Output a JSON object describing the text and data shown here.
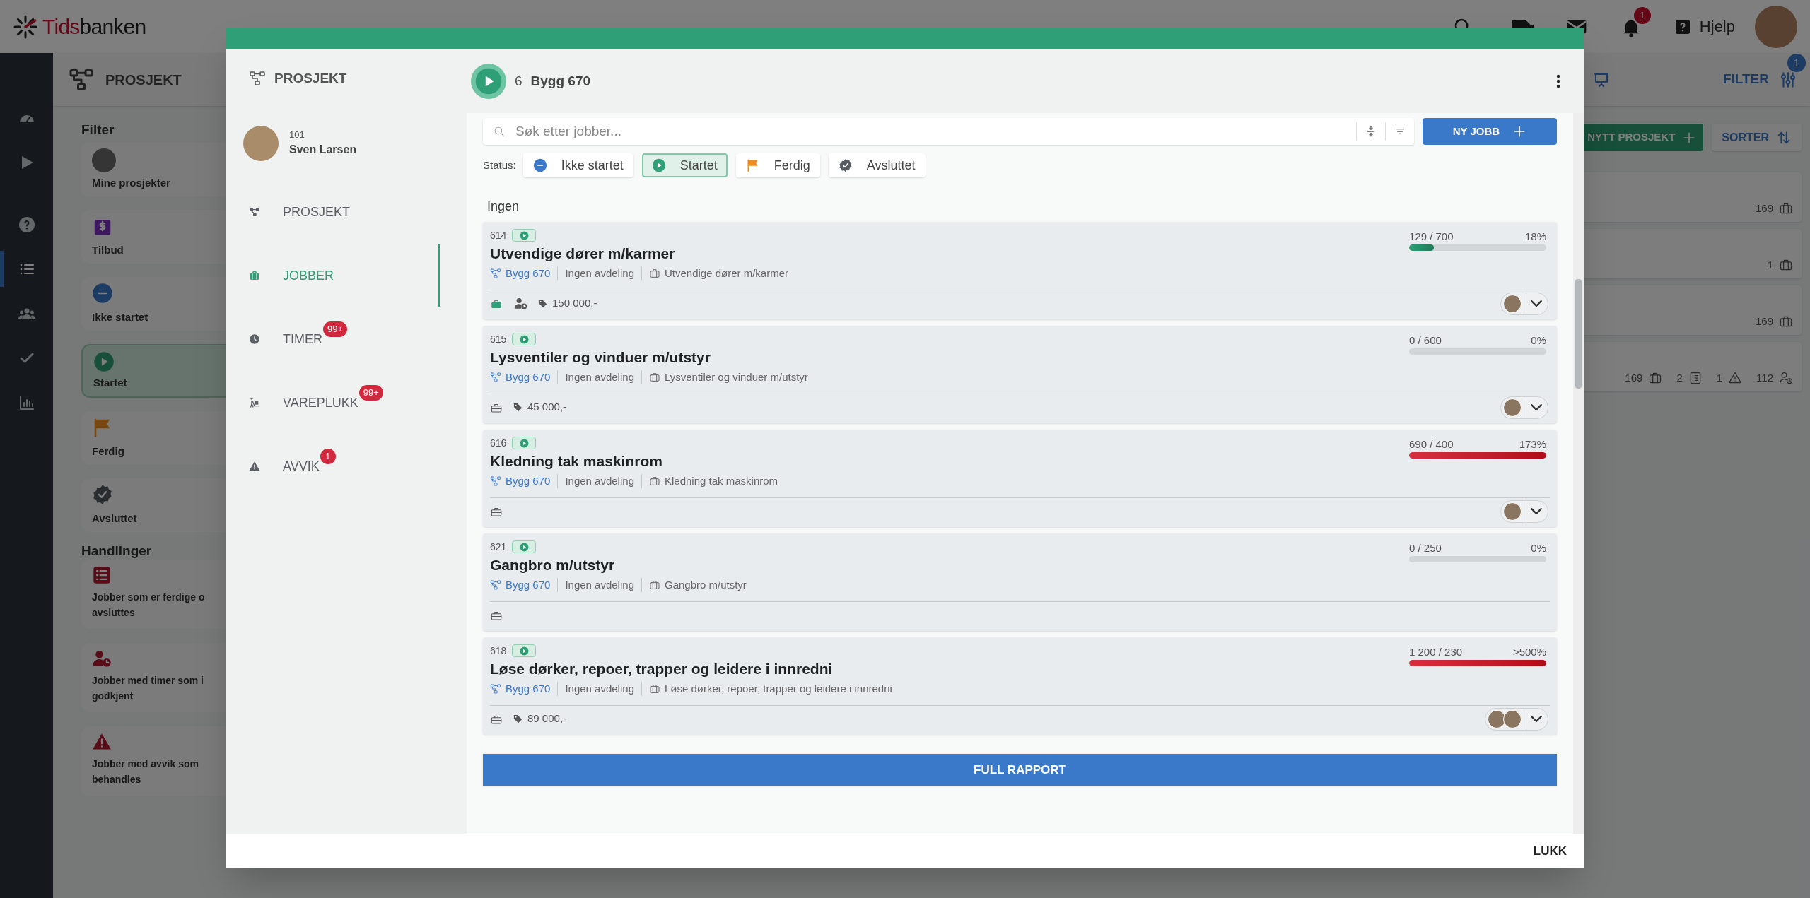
{
  "app": {
    "logo": {
      "accent": "Tids",
      "rest": "banken"
    },
    "help_label": "Hjelp",
    "notification_count": "1"
  },
  "rail": {
    "top": [
      {
        "kind": "dashboard",
        "selected": false
      },
      {
        "kind": "play",
        "selected": false
      }
    ],
    "bottom": [
      {
        "kind": "help",
        "selected": false
      },
      {
        "kind": "list",
        "selected": true
      },
      {
        "kind": "users",
        "selected": false
      },
      {
        "kind": "check",
        "selected": false
      },
      {
        "kind": "chart",
        "selected": false
      }
    ]
  },
  "page_header": {
    "title": "PROSJEKT",
    "filter_label": "FILTER",
    "filter_count": "1"
  },
  "sidebar": {
    "filter_heading": "Filter",
    "filters": [
      {
        "label": "Mine prosjekter",
        "kind": "photo",
        "selected": false
      },
      {
        "label": "Tilbud",
        "kind": "offer",
        "selected": false
      },
      {
        "label": "Ikke startet",
        "kind": "not_started",
        "selected": false
      },
      {
        "label": "Startet",
        "kind": "started",
        "selected": true
      },
      {
        "label": "Ferdig",
        "kind": "done",
        "selected": false
      },
      {
        "label": "Avsluttet",
        "kind": "closed",
        "selected": false
      }
    ],
    "actions_heading": "Handlinger",
    "actions": [
      {
        "label": "Jobber som er ferdige o\navsluttes",
        "kind": "jobs_done"
      },
      {
        "label": "Jobber med timer som i\ngodkjent",
        "kind": "hours_pending"
      },
      {
        "label": "Jobber med avvik som\nbehandles",
        "kind": "deviations"
      }
    ]
  },
  "toolbar": {
    "new_label": "NYTT PROSJEKT",
    "sort_label": "SORTER"
  },
  "project_cards": [
    {
      "stats": [
        {
          "value": "169",
          "kind": "jobs"
        }
      ]
    },
    {
      "stats": [
        {
          "value": "1",
          "kind": "jobs"
        }
      ]
    },
    {
      "stats": [
        {
          "value": "169",
          "kind": "jobs"
        }
      ]
    },
    {
      "stats": [
        {
          "value": "169",
          "kind": "jobs"
        },
        {
          "value": "2",
          "kind": "checklists"
        },
        {
          "value": "1",
          "kind": "deviations"
        },
        {
          "value": "112",
          "kind": "hours"
        }
      ]
    }
  ],
  "modal": {
    "title": "PROSJEKT",
    "user": {
      "number": "101",
      "name": "Sven Larsen"
    },
    "nav": [
      {
        "label": "PROSJEKT",
        "kind": "project",
        "selected": false
      },
      {
        "label": "JOBBER",
        "kind": "jobs",
        "selected": true
      },
      {
        "label": "TIMER",
        "kind": "hours",
        "badge": "99+",
        "selected": false
      },
      {
        "label": "VAREPLUKK",
        "kind": "picking",
        "badge": "99+",
        "selected": false
      },
      {
        "label": "AVVIK",
        "kind": "deviations",
        "badge": "1",
        "selected": false
      }
    ],
    "project": {
      "kind": "started",
      "number": "6",
      "name": "Bygg 670"
    },
    "search": {
      "placeholder": "Søk etter jobber..."
    },
    "new_job_label": "NY JOBB",
    "status_label": "Status:",
    "statuses": [
      {
        "label": "Ikke startet",
        "kind": "not_started",
        "selected": false
      },
      {
        "label": "Startet",
        "kind": "started",
        "selected": true
      },
      {
        "label": "Ferdig",
        "kind": "done",
        "selected": false
      },
      {
        "label": "Avsluttet",
        "kind": "closed",
        "selected": false
      }
    ],
    "group_label": "Ingen",
    "jobs": [
      {
        "number": "614",
        "kind": "started",
        "title": "Utvendige dører m/karmer",
        "project": "Bygg 670",
        "department": "Ingen avdeling",
        "description": "Utvendige dører m/karmer",
        "hours": "129 / 700",
        "percent": "18%",
        "level": 0.18,
        "over_budget": false,
        "equipment_active": true,
        "timer_pending": true,
        "price": "150 000,-",
        "assignees": [
          {
            "kind": "photo"
          }
        ],
        "expandable": true
      },
      {
        "number": "615",
        "kind": "started",
        "title": "Lysventiler og vinduer m/utstyr",
        "project": "Bygg 670",
        "department": "Ingen avdeling",
        "description": "Lysventiler og vinduer m/utstyr",
        "hours": "0 / 600",
        "percent": "0%",
        "level": 0,
        "equipment_active": false,
        "timer_pending": false,
        "price": "45 000,-",
        "assignees": [
          {
            "kind": "photo"
          }
        ],
        "expandable": true
      },
      {
        "number": "616",
        "kind": "started",
        "title": "Kledning tak maskinrom",
        "project": "Bygg 670",
        "department": "Ingen avdeling",
        "description": "Kledning tak maskinrom",
        "hours": "690 / 400",
        "percent": "173%",
        "level": 1,
        "over_budget": true,
        "equipment_active": false,
        "timer_pending": false,
        "assignees": [
          {
            "kind": "photo"
          }
        ],
        "expandable": true
      },
      {
        "number": "621",
        "kind": "started",
        "title": "Gangbro m/utstyr",
        "project": "Bygg 670",
        "department": "Ingen avdeling",
        "description": "Gangbro m/utstyr",
        "hours": "0 / 250",
        "percent": "0%",
        "level": 0,
        "equipment_active": false,
        "timer_pending": false,
        "expandable": false
      },
      {
        "number": "618",
        "kind": "started",
        "title": "Løse dørker, repoer, trapper og leidere i innredni",
        "project": "Bygg 670",
        "department": "Ingen avdeling",
        "description": "Løse dørker, repoer, trapper og leidere i innredni",
        "hours": "1 200 / 230",
        "percent": ">500%",
        "level": 1,
        "over_budget": true,
        "equipment_active": false,
        "timer_pending": false,
        "price": "89 000,-",
        "assignees": [
          {
            "kind": "photo"
          },
          {
            "kind": "photo"
          }
        ],
        "expandable": true
      }
    ],
    "report_label": "FULL RAPPORT",
    "close_label": "LUKK"
  }
}
